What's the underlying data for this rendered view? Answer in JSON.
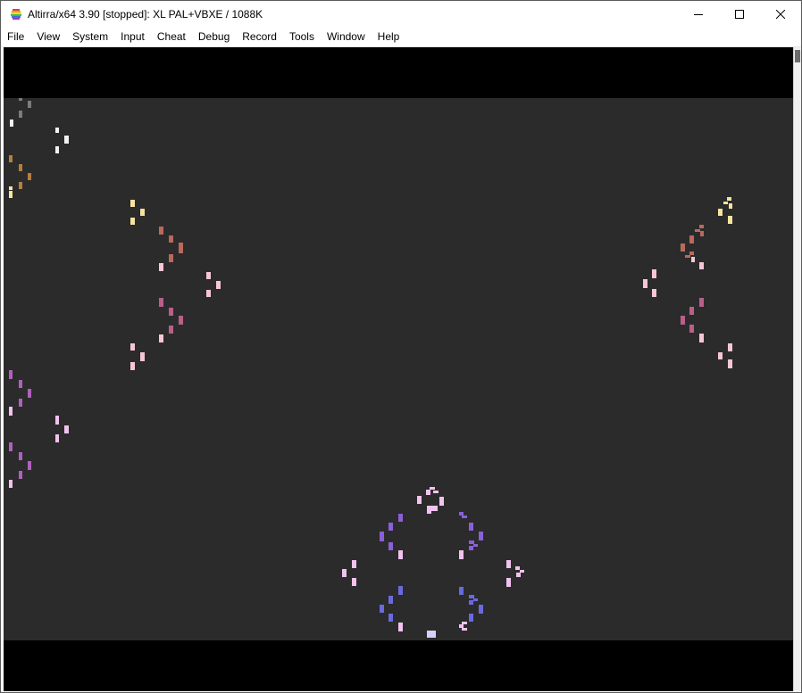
{
  "window": {
    "title": "Altirra/x64 3.90 [stopped]: XL PAL+VBXE / 1088K",
    "app_icon": "altirra-rainbow-icon",
    "controls": [
      "minimize-icon",
      "maximize-icon",
      "close-icon"
    ]
  },
  "menu": {
    "items": [
      "File",
      "View",
      "System",
      "Input",
      "Cheat",
      "Debug",
      "Record",
      "Tools",
      "Window",
      "Help"
    ]
  },
  "display": {
    "border_color": "#000000",
    "playfield_color": "#2b2b2b",
    "sprite_palette": {
      "gray": "#7c7c7c",
      "white": "#f2f2f2",
      "amber": "#b5803a",
      "pale_yellow": "#f6e3a0",
      "salmon": "#b86a5c",
      "pink": "#f6c6d6",
      "rose": "#b8608a",
      "magenta": "#b060c0",
      "light_pink": "#f2c2f0",
      "violet": "#8a60d8",
      "blue_violet": "#6a6ae0",
      "lavender": "#d8d0f8"
    }
  }
}
